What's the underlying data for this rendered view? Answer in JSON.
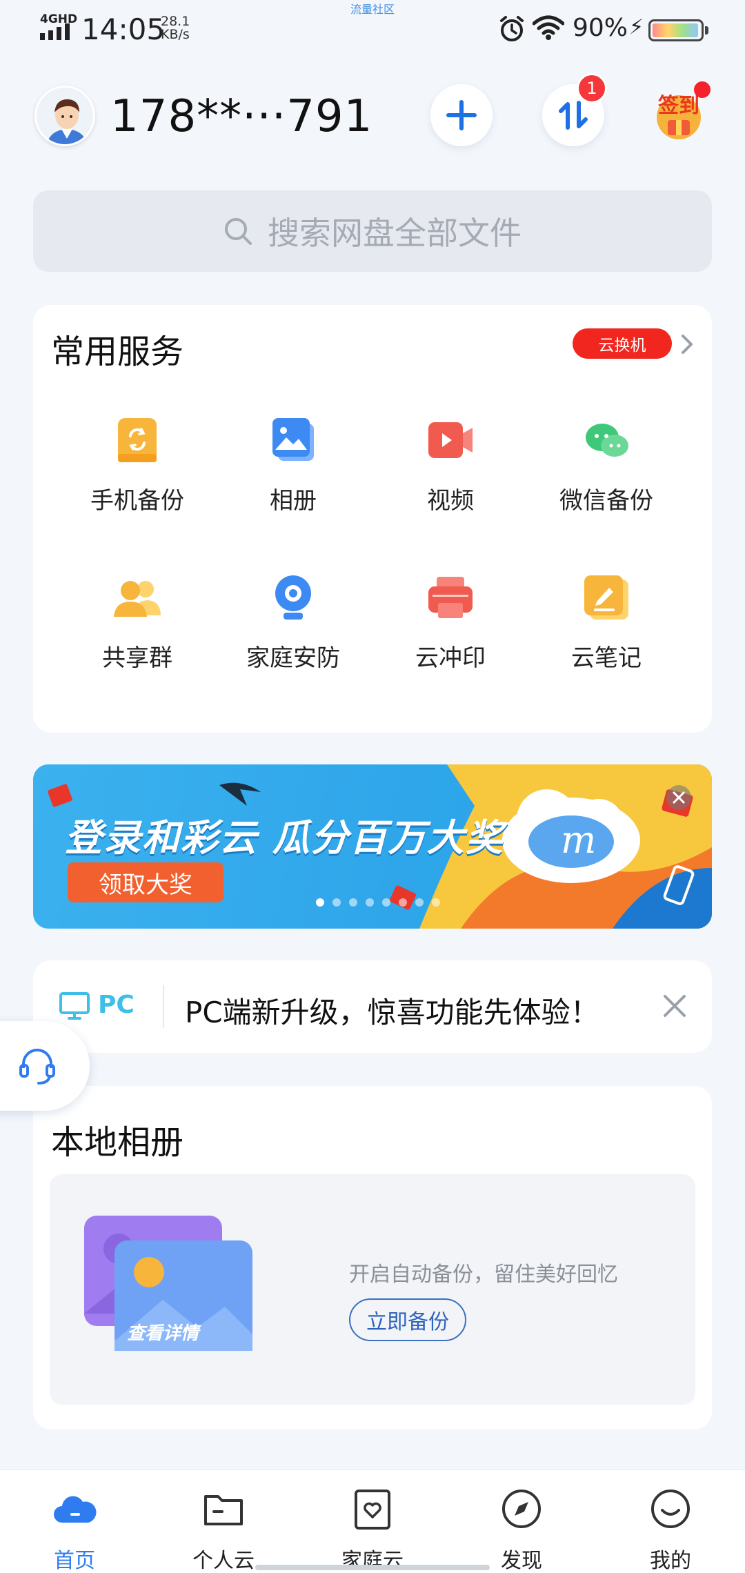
{
  "status_bar": {
    "network": "4GHD",
    "time": "14:05",
    "speed_value": "28.1",
    "speed_unit": "KB/s",
    "carrier_overlay": "流量社区",
    "battery": "90%"
  },
  "header": {
    "username": "178**···791",
    "transfer_badge": "1",
    "signin_label": "签到"
  },
  "search": {
    "placeholder": "搜索网盘全部文件"
  },
  "services": {
    "title": "常用服务",
    "promo_label": "云换机",
    "items": [
      {
        "label": "手机备份",
        "icon": "phone-backup-icon",
        "color": "#f7b53b"
      },
      {
        "label": "相册",
        "icon": "album-icon",
        "color": "#3d8bf2"
      },
      {
        "label": "视频",
        "icon": "video-icon",
        "color": "#f05a4f"
      },
      {
        "label": "微信备份",
        "icon": "wechat-icon",
        "color": "#3fc77a"
      },
      {
        "label": "共享群",
        "icon": "share-group-icon",
        "color": "#f7b53b"
      },
      {
        "label": "家庭安防",
        "icon": "home-security-icon",
        "color": "#3d8bf2"
      },
      {
        "label": "云冲印",
        "icon": "cloud-print-icon",
        "color": "#f05a4f"
      },
      {
        "label": "云笔记",
        "icon": "cloud-note-icon",
        "color": "#f7b53b"
      }
    ]
  },
  "banner": {
    "title": "登录和彩云 瓜分百万大奖",
    "button": "领取大奖",
    "dots": 8,
    "active_dot": 0
  },
  "notice": {
    "badge": "PC",
    "text": "PC端新升级，惊喜功能先体验！"
  },
  "local_album": {
    "title": "本地相册",
    "art_text": "查看详情",
    "tip": "开启自动备份，留住美好回忆",
    "button": "立即备份"
  },
  "tabs": [
    {
      "label": "首页",
      "icon": "home-cloud-icon",
      "active": true
    },
    {
      "label": "个人云",
      "icon": "folder-icon",
      "active": false
    },
    {
      "label": "家庭云",
      "icon": "family-heart-icon",
      "active": false
    },
    {
      "label": "发现",
      "icon": "compass-icon",
      "active": false
    },
    {
      "label": "我的",
      "icon": "smile-icon",
      "active": false
    }
  ],
  "colors": {
    "accent": "#2f7cf0",
    "promo_red": "#f0261f",
    "banner_blue": "#2fa6ea"
  }
}
